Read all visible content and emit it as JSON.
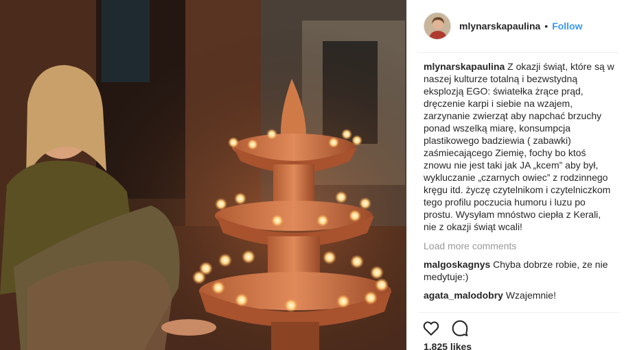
{
  "header": {
    "username": "mlynarskapaulina",
    "separator": "•",
    "follow_label": "Follow"
  },
  "caption": {
    "username": "mlynarskapaulina",
    "text": "Z okazji świąt, które są w naszej kulturze totalną i bezwstydną eksplozją EGO: światełka żrące prąd, dręczenie karpi i siebie na wzajem, zarzynanie zwierząt aby napchać brzuchy ponad wszelką miarę, konsumpcja plastikowego badziewia ( zabawki) zaśmiecającego Ziemię, fochy bo ktoś znowu nie jest taki jak JA „kcem” aby był, wykluczanie „czarnych owiec” z rodzinnego kręgu itd. życzę czytelnikom i czytelniczkom tego profilu poczucia humoru i luzu po prostu. Wysyłam mnóstwo ciepła z Kerali, nie z okazji świąt wcali!"
  },
  "load_more_label": "Load more comments",
  "comments": [
    {
      "username": "malgoskagnys",
      "text": "Chyba dobrze robie, ze nie medytuje:)"
    },
    {
      "username": "agata_malodobry",
      "text": "Wzajemnie!"
    }
  ],
  "actions": {
    "like_icon": "heart-icon",
    "comment_icon": "comment-bubble-icon"
  },
  "likes_text": "1,825 likes",
  "colors": {
    "link_blue": "#3897f0",
    "muted_gray": "#999999",
    "text": "#262626"
  }
}
